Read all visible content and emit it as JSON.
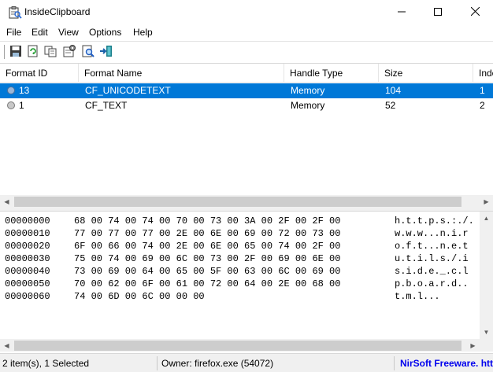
{
  "window": {
    "title": "InsideClipboard",
    "app_icon": "clipboard-magnifier-icon",
    "controls": [
      "minimize-icon",
      "maximize-icon",
      "close-icon"
    ]
  },
  "menu": [
    "File",
    "Edit",
    "View",
    "Options",
    "Help"
  ],
  "toolbar": {
    "buttons": [
      "save-icon",
      "refresh-icon",
      "copy-icon",
      "properties-icon",
      "find-icon",
      "exit-icon"
    ]
  },
  "list": {
    "columns": [
      "Format ID",
      "Format Name",
      "Handle Type",
      "Size",
      "Index"
    ],
    "rows": [
      {
        "format_id": "13",
        "format_name": "CF_UNICODETEXT",
        "handle_type": "Memory",
        "size": "104",
        "index": "1",
        "selected": true
      },
      {
        "format_id": "1",
        "format_name": "CF_TEXT",
        "handle_type": "Memory",
        "size": "52",
        "index": "2",
        "selected": false
      }
    ]
  },
  "hex": {
    "lines": [
      {
        "offset": "00000000",
        "bytes": "68 00 74 00 74 00 70 00 73 00 3A 00 2F 00 2F 00",
        "ascii": "h.t.t.p.s.:./."
      },
      {
        "offset": "00000010",
        "bytes": "77 00 77 00 77 00 2E 00 6E 00 69 00 72 00 73 00",
        "ascii": "w.w.w...n.i.r"
      },
      {
        "offset": "00000020",
        "bytes": "6F 00 66 00 74 00 2E 00 6E 00 65 00 74 00 2F 00",
        "ascii": "o.f.t...n.e.t"
      },
      {
        "offset": "00000030",
        "bytes": "75 00 74 00 69 00 6C 00 73 00 2F 00 69 00 6E 00",
        "ascii": "u.t.i.l.s./.i"
      },
      {
        "offset": "00000040",
        "bytes": "73 00 69 00 64 00 65 00 5F 00 63 00 6C 00 69 00",
        "ascii": "s.i.d.e._.c.l"
      },
      {
        "offset": "00000050",
        "bytes": "70 00 62 00 6F 00 61 00 72 00 64 00 2E 00 68 00",
        "ascii": "p.b.o.a.r.d.."
      },
      {
        "offset": "00000060",
        "bytes": "74 00 6D 00 6C 00 00 00",
        "ascii": "t.m.l..."
      }
    ]
  },
  "status": {
    "items": "2 item(s), 1 Selected",
    "owner": "Owner: firefox.exe (54072)",
    "credit": "NirSoft Freeware. htt"
  },
  "colors": {
    "selection": "#0078d7",
    "link": "#0000ee",
    "chrome": "#f0f0f0"
  }
}
